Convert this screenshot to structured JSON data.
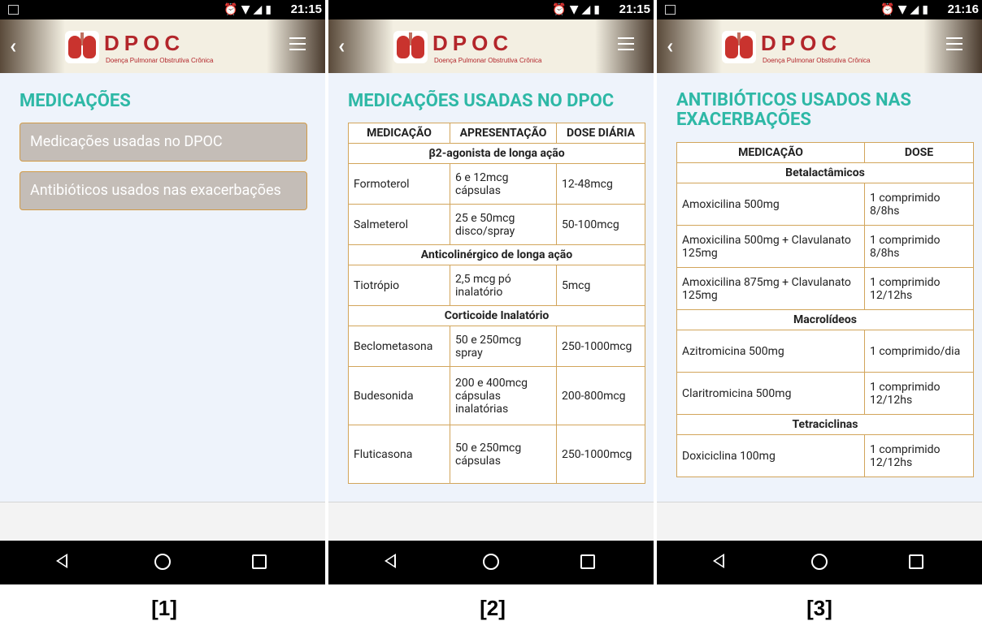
{
  "screens": [
    {
      "status_time": "21:15",
      "header": {
        "logo_title": "DPOC",
        "logo_subtitle": "Doença Pulmonar Obstrutiva Crônica"
      },
      "title": "MEDICAÇÕES",
      "buttons": [
        "Medicações usadas no DPOC",
        "Antibióticos usados nas exacerbações"
      ],
      "caption": "[1]"
    },
    {
      "status_time": "21:15",
      "header": {
        "logo_title": "DPOC",
        "logo_subtitle": "Doença Pulmonar Obstrutiva Crônica"
      },
      "title": "MEDICAÇÕES USADAS NO DPOC",
      "table": {
        "headers": [
          "MEDICAÇÃO",
          "APRESENTAÇÃO",
          "DOSE DIÁRIA"
        ],
        "groups": [
          {
            "name": "β2-agonista de longa ação",
            "rows": [
              [
                "Formoterol",
                "6 e 12mcg cápsulas",
                "12-48mcg"
              ],
              [
                "Salmeterol",
                "25 e 50mcg disco/spray",
                "50-100mcg"
              ]
            ]
          },
          {
            "name": "Anticolinérgico de longa ação",
            "rows": [
              [
                "Tiotrópio",
                "2,5 mcg pó inalatório",
                "5mcg"
              ]
            ]
          },
          {
            "name": "Corticoide Inalatório",
            "rows": [
              [
                "Beclometasona",
                "50 e 250mcg spray",
                "250-1000mcg"
              ],
              [
                "Budesonida",
                "200 e 400mcg cápsulas inalatórias",
                "200-800mcg"
              ],
              [
                "Fluticasona",
                "50 e 250mcg cápsulas",
                "250-1000mcg"
              ]
            ]
          }
        ]
      },
      "caption": "[2]"
    },
    {
      "status_time": "21:16",
      "header": {
        "logo_title": "DPOC",
        "logo_subtitle": "Doença Pulmonar Obstrutiva Crônica"
      },
      "title": "ANTIBIÓTICOS USADOS NAS EXACERBAÇÕES",
      "table": {
        "headers": [
          "MEDICAÇÃO",
          "DOSE"
        ],
        "groups": [
          {
            "name": "Betalactâmicos",
            "rows": [
              [
                "Amoxicilina 500mg",
                "1 comprimido 8/8hs"
              ],
              [
                "Amoxicilina 500mg + Clavulanato 125mg",
                "1 comprimido 8/8hs"
              ],
              [
                "Amoxicilina 875mg + Clavulanato 125mg",
                "1 comprimido 12/12hs"
              ]
            ]
          },
          {
            "name": "Macrolídeos",
            "rows": [
              [
                "Azitromicina 500mg",
                "1 comprimido/dia"
              ],
              [
                "Claritromicina 500mg",
                "1 comprimido 12/12hs"
              ]
            ]
          },
          {
            "name": "Tetraciclinas",
            "rows": [
              [
                "Doxiciclina 100mg",
                "1 comprimido 12/12hs"
              ]
            ]
          }
        ]
      },
      "caption": "[3]"
    }
  ]
}
